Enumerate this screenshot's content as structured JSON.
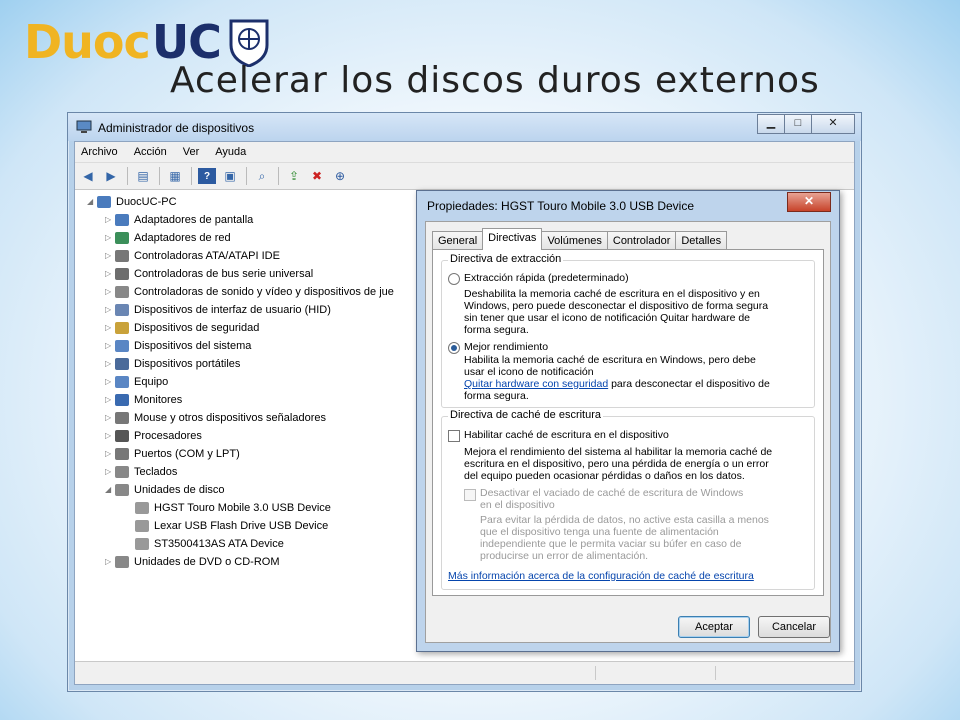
{
  "slide": {
    "logo_duoc": "Duoc",
    "logo_uc": "UC",
    "title": "Acelerar los discos duros externos"
  },
  "window": {
    "title": "Administrador de dispositivos",
    "controls": {
      "minimize": "▁",
      "maximize": "□",
      "close": "✕"
    },
    "menu": [
      "Archivo",
      "Acción",
      "Ver",
      "Ayuda"
    ],
    "toolbar_icons": [
      "back-arrow-icon",
      "forward-arrow-icon",
      "properties-icon",
      "list-icon",
      "help-icon",
      "view-icon",
      "scan-hardware-icon",
      "update-driver-icon",
      "uninstall-icon",
      "enable-icon"
    ]
  },
  "tree": {
    "root": "DuocUC-PC",
    "items": [
      "Adaptadores de pantalla",
      "Adaptadores de red",
      "Controladoras ATA/ATAPI IDE",
      "Controladoras de bus serie universal",
      "Controladoras de sonido y vídeo y dispositivos de jue",
      "Dispositivos de interfaz de usuario (HID)",
      "Dispositivos de seguridad",
      "Dispositivos del sistema",
      "Dispositivos portátiles",
      "Equipo",
      "Monitores",
      "Mouse y otros dispositivos señaladores",
      "Procesadores",
      "Puertos (COM y LPT)",
      "Teclados",
      "Unidades de disco"
    ],
    "disk_children": [
      "HGST Touro Mobile 3.0 USB Device",
      "Lexar USB Flash Drive USB Device",
      "ST3500413AS ATA Device"
    ],
    "last": "Unidades de DVD o CD-ROM"
  },
  "dialog": {
    "title": "Propiedades: HGST Touro Mobile 3.0 USB Device",
    "close": "✕",
    "tabs": [
      "General",
      "Directivas",
      "Volúmenes",
      "Controlador",
      "Detalles"
    ],
    "active_tab": "Directivas",
    "removal": {
      "label": "Directiva de extracción",
      "quick_label": "Extracción rápida (predeterminado)",
      "quick_desc": [
        "Deshabilita la memoria caché de escritura en el dispositivo y en",
        "Windows, pero puede desconectar el dispositivo de forma segura",
        "sin tener que usar el icono de notificación Quitar hardware de",
        "forma segura."
      ],
      "best_label": "Mejor rendimiento",
      "best_desc": [
        "Habilita la memoria caché de escritura en Windows, pero debe",
        "usar el icono de notificación"
      ],
      "best_link": "Quitar hardware con seguridad",
      "best_after_link": " para desconectar el dispositivo de",
      "best_last": "forma segura.",
      "selected": "best"
    },
    "cache": {
      "label": "Directiva de caché de escritura",
      "enable_label": "Habilitar caché de escritura en el dispositivo",
      "enable_desc": [
        "Mejora el rendimiento del sistema al habilitar la memoria caché de",
        "escritura en el dispositivo, pero una pérdida de energía o un error",
        "del equipo pueden ocasionar pérdidas o daños en los datos."
      ],
      "flush_label": [
        "Desactivar el vaciado de caché de escritura de Windows",
        "en el dispositivo"
      ],
      "flush_desc": [
        "Para evitar la pérdida de datos, no active esta casilla a menos",
        "que el dispositivo tenga una fuente de alimentación",
        "independiente que le permita vaciar su búfer en caso de",
        "producirse un error de alimentación."
      ],
      "more_link": "Más información acerca de la configuración de caché de escritura"
    },
    "ok": "Aceptar",
    "cancel": "Cancelar"
  },
  "colors": {
    "logo_gold": "#f0b422",
    "logo_navy": "#1c2f6b",
    "link": "#0645ad"
  }
}
